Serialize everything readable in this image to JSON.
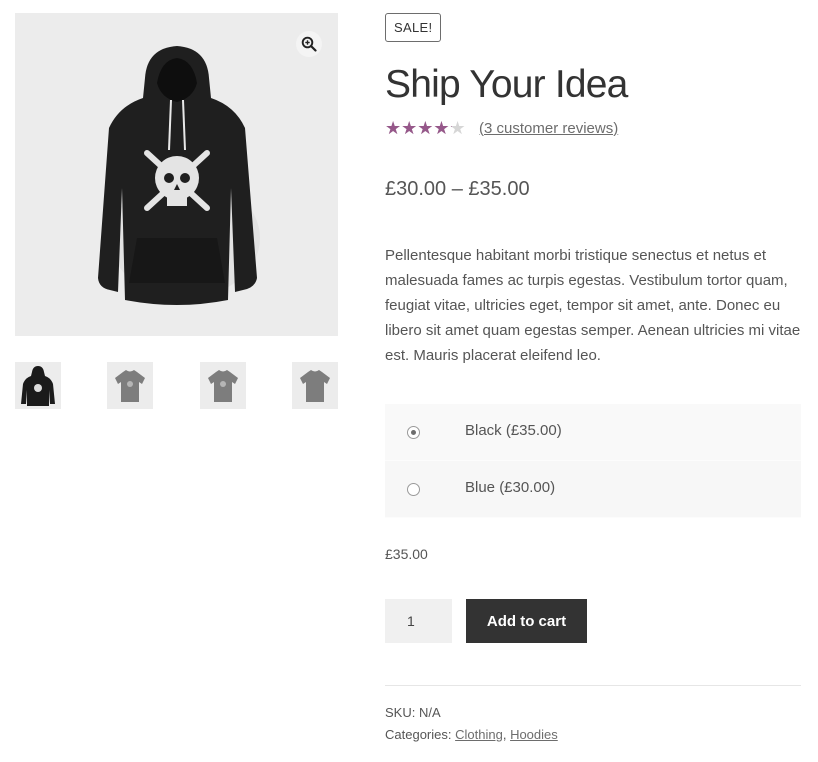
{
  "gallery": {
    "zoom_icon": "zoom-in-icon",
    "thumbnails": [
      {
        "name": "black-hoodie",
        "color": "#1b1b1b"
      },
      {
        "name": "grey-tshirt",
        "color": "#7d7d7d"
      },
      {
        "name": "grey-tshirt",
        "color": "#7d7d7d"
      },
      {
        "name": "grey-tshirt",
        "color": "#7d7d7d"
      }
    ]
  },
  "product": {
    "badge": "SALE!",
    "title": "Ship Your Idea",
    "rating": 0.8,
    "reviews_link": "(3 customer reviews)",
    "price_range": "£30.00 – £35.00",
    "description": "Pellentesque habitant morbi tristique senectus et netus et malesuada fames ac turpis egestas. Vestibulum tortor quam, feugiat vitae, ultricies eget, tempor sit amet, ante. Donec eu libero sit amet quam egestas semper. Aenean ultricies mi vitae est. Mauris placerat eleifend leo.",
    "variations": [
      {
        "label": "Black (£35.00)",
        "selected": true
      },
      {
        "label": "Blue (£30.00)",
        "selected": false
      }
    ],
    "selected_price": "£35.00",
    "quantity": "1",
    "add_to_cart_label": "Add to cart"
  },
  "meta": {
    "sku_label": "SKU:",
    "sku_value": "N/A",
    "categories_label": "Categories:",
    "category_1": "Clothing",
    "separator": ",",
    "category_2": "Hoodies"
  },
  "colors": {
    "star_fill": "#96588a",
    "button_bg": "#333333",
    "image_bg": "#ececec"
  }
}
